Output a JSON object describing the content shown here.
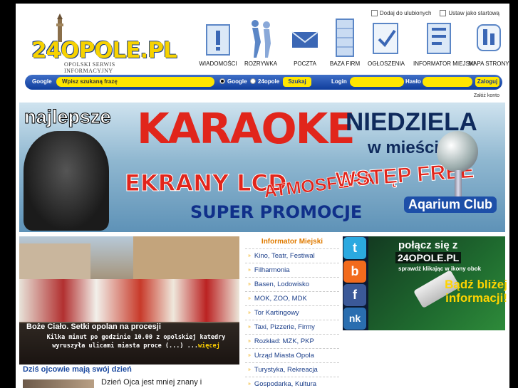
{
  "header": {
    "logo_text": "24OPOLE.PL",
    "logo_subtitle": "OPOLSKI SERWIS INFORMACYJNY",
    "top_links": [
      {
        "label": "Dodaj do ulubionych",
        "icon": "bookmark-icon"
      },
      {
        "label": "Ustaw jako startową",
        "icon": "home-page-icon"
      }
    ],
    "nav": [
      {
        "label": "WIADOMOŚCI",
        "icon": "news-icon"
      },
      {
        "label": "ROZRYWKA",
        "icon": "entertainment-icon"
      },
      {
        "label": "POCZTA",
        "icon": "mail-icon"
      },
      {
        "label": "BAZA FIRM",
        "icon": "business-directory-icon"
      },
      {
        "label": "OGŁOSZENIA",
        "icon": "classifieds-icon"
      },
      {
        "label": "INFORMATOR MIEJSKI",
        "icon": "city-guide-icon"
      },
      {
        "label": "MAPA STRONY",
        "icon": "sitemap-icon"
      }
    ]
  },
  "searchbar": {
    "google_label": "Google",
    "search_placeholder": "Wpisz szukaną frazę",
    "radio_google": "Google",
    "radio_site": "24opole",
    "search_button": "Szukaj",
    "login_label": "Login",
    "password_label": "Hasło",
    "login_button": "Zaloguj",
    "register_link": "Załóż konto"
  },
  "banner": {
    "line1": "najlepsze",
    "line2": "KARAOKE",
    "line3": "NIEDZIELA",
    "line4": "w mieście",
    "line5": "EKRANY LCD",
    "line6": "ATMOSFERA",
    "line7": "WSTĘP FREE",
    "line8": "SUPER PROMOCJE",
    "club": "Aqarium Club"
  },
  "news": {
    "title": "Boże Ciało. Setki opolan na procesji",
    "excerpt": "Kilka minut po godzinie 10.00 z opolskiej katedry wyruszyła ulicami miasta proce (...) ...",
    "more": "więcej",
    "second_title": "Dziś ojcowie mają swój dzień",
    "second_text": "Dzień Ojca jest mniej znany i"
  },
  "informator": {
    "title": "Informator Miejski",
    "items": [
      "Kino, Teatr, Festiwal",
      "Filharmonia",
      "Basen, Lodowisko",
      "MOK, ZOO, MDK",
      "Tor Kartingowy",
      "Taxi, Pizzerie, Firmy",
      "Rozkład: MZK, PKP",
      "Urząd Miasta Opola",
      "Turystyka, Rekreacja",
      "Gospodarka, Kultura"
    ]
  },
  "social": {
    "icons": [
      {
        "label": "t",
        "name": "twitter-icon",
        "color": "#2ba9e0"
      },
      {
        "label": "b",
        "name": "blip-icon",
        "color": "#f26b1d"
      },
      {
        "label": "f",
        "name": "facebook-icon",
        "color": "#3b5998"
      },
      {
        "label": "nk",
        "name": "nasza-klasa-icon",
        "color": "#2a6eb0"
      }
    ],
    "promo_line1": "połącz się z",
    "promo_line2": "24OPOLE.PL",
    "promo_line3": "sprawdź klikając w ikony obok",
    "promo_line4": "Bądź bliżej informacji!"
  }
}
